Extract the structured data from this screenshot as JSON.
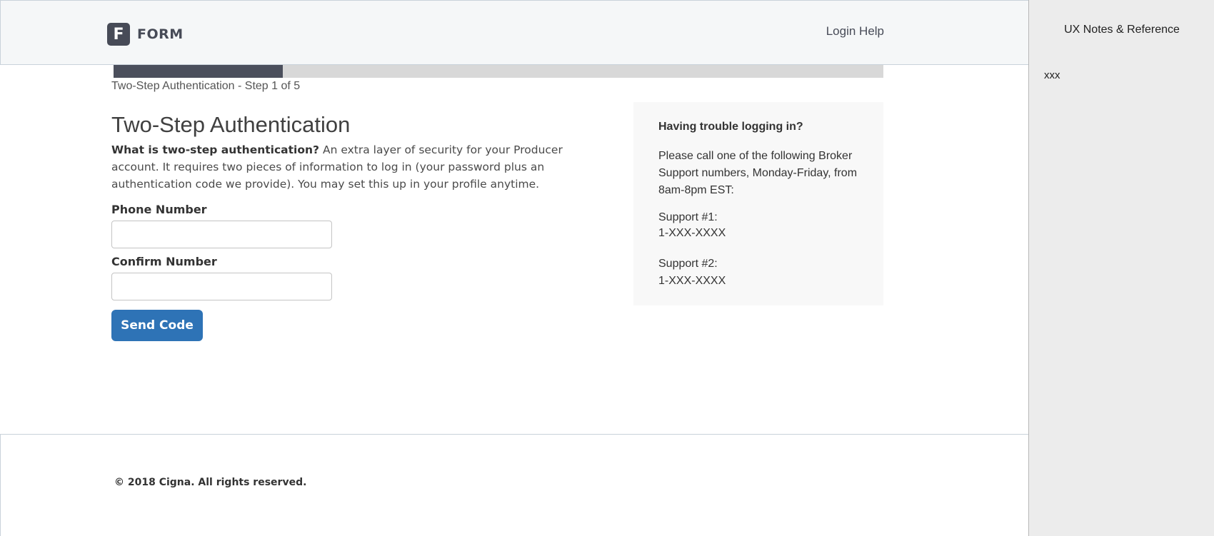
{
  "header": {
    "logo_mark": "F",
    "logo_text": "FORM",
    "login_help": "Login Help"
  },
  "progress": {
    "fraction": 0.22,
    "step_label": "Two-Step Authentication - Step 1 of 5"
  },
  "content": {
    "title": "Two-Step Authentication",
    "desc_lead": "What is two-step authentication?",
    "desc_body": " An extra layer of security for your Producer account. It requires two pieces of information to log in (your password plus an authentication code we provide). You may set this up in your profile anytime.",
    "phone_label": "Phone Number",
    "phone_value": "",
    "confirm_label": "Confirm Number",
    "confirm_value": "",
    "send_button": "Send Code"
  },
  "help": {
    "title": "Having trouble logging in?",
    "text": "Please call one of the following Broker Support numbers, Monday-Friday, from 8am-8pm EST:",
    "support1_label": "Support #1:",
    "support1_number": "1-XXX-XXXX",
    "support2_label": "Support #2:",
    "support2_number": "1-XXX-XXXX"
  },
  "footer": {
    "copyright": "© 2018 Cigna. All rights reserved."
  },
  "notes": {
    "title": "UX Notes & Reference",
    "body": "xxx"
  },
  "colors": {
    "brand_dark": "#474b57",
    "primary_button": "#2e73b6",
    "progress_fill": "#4b4f5c",
    "progress_track": "#d8d8d8"
  }
}
